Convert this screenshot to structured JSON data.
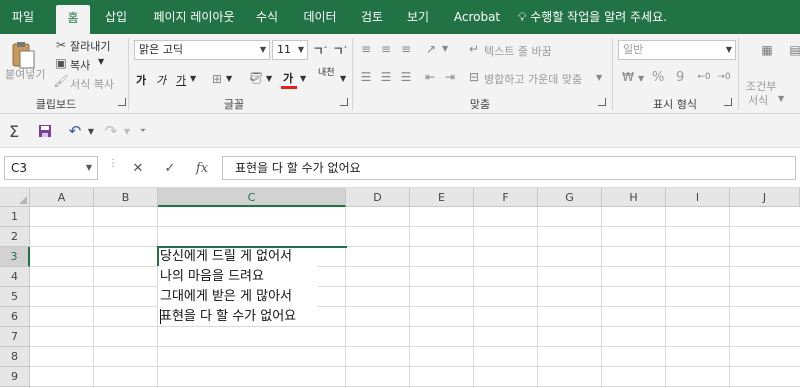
{
  "ribbon_tabs": [
    "파일",
    "홈",
    "삽입",
    "페이지 레이아웃",
    "수식",
    "데이터",
    "검토",
    "보기",
    "Acrobat"
  ],
  "tell_me": "수행할 작업을 알려 주세요.",
  "clipboard": {
    "paste": "붙여넣기",
    "cut": "잘라내기",
    "copy": "복사",
    "format_painter": "서식 복사",
    "group_label": "클립보드"
  },
  "font": {
    "name": "맑은 고딕",
    "size": "11",
    "bold": "가",
    "italic": "가",
    "underline": "가",
    "font_color_glyph": "가",
    "phonetic": "내천",
    "group_label": "글꼴"
  },
  "alignment": {
    "wrap_text": "텍스트 줄 바꿈",
    "merge_center": "병합하고 가운데 맞춤",
    "group_label": "맞춤"
  },
  "number": {
    "format": "일반",
    "percent": "%",
    "comma": "9",
    "group_label": "표시 형식"
  },
  "styles": {
    "conditional_1": "조건부",
    "conditional_2": "서식"
  },
  "name_box": "C3",
  "formula_bar_value": "표현을 다 할 수가 없어요",
  "columns": [
    "A",
    "B",
    "C",
    "D",
    "E",
    "F",
    "G",
    "H",
    "I",
    "J"
  ],
  "rows": [
    "1",
    "2",
    "3",
    "4",
    "5",
    "6",
    "7",
    "8",
    "9"
  ],
  "cells": {
    "C3": "당신에게 드릴 게 없어서",
    "C4": "나의 마음을 드려요",
    "C5": "그대에게 받은 게 많아서",
    "C6": "표현을 다 할 수가 없어요"
  },
  "selected_column": "C",
  "selected_row": "3",
  "colors": {
    "accent": "#217346",
    "font_color_bar": "#e02020"
  }
}
